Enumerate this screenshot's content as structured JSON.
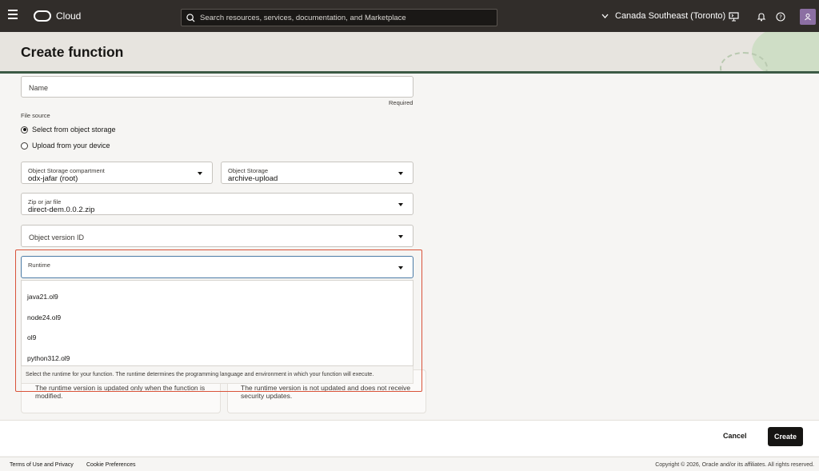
{
  "topbar": {
    "brand": "Cloud",
    "search_placeholder": "Search resources, services, documentation, and Marketplace",
    "region": "Canada Southeast (Toronto)"
  },
  "page": {
    "title": "Create function"
  },
  "form": {
    "name_label": "Name",
    "required": "Required",
    "file_source_label": "File source",
    "file_source_options": [
      "Select from object storage",
      "Upload from your device"
    ],
    "compartment": {
      "label": "Object Storage compartment",
      "value": "odx-jafar (root)"
    },
    "bucket": {
      "label": "Object Storage",
      "value": "archive-upload"
    },
    "zip": {
      "label": "Zip or jar file",
      "value": "direct-dem.0.0.2.zip"
    },
    "object_version": "Object version ID",
    "runtime": {
      "label": "Runtime",
      "options": [
        "java21.ol9",
        "node24.ol9",
        "ol9",
        "python312.ol9"
      ],
      "help": "Select the runtime for your function. The runtime determines the programming language and environment in which your function will execute."
    },
    "card_left": "The runtime version is updated only when the function is modified.",
    "card_right": "The runtime version is not updated and does not receive security updates."
  },
  "actions": {
    "cancel": "Cancel",
    "create": "Create"
  },
  "footer": {
    "terms": "Terms of Use and Privacy",
    "cookies": "Cookie Preferences",
    "copyright": "Copyright © 2026, Oracle and/or its affiliates. All rights reserved."
  }
}
